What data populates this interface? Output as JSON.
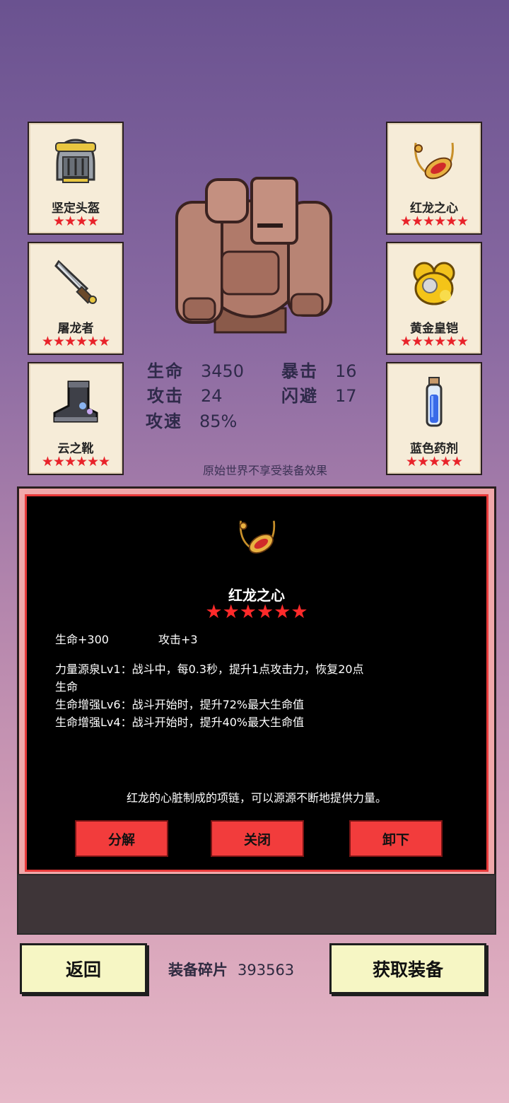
{
  "equipment": {
    "left": [
      {
        "name": "坚定头盔",
        "stars": "★★★★",
        "icon": "knight-helmet-icon"
      },
      {
        "name": "屠龙者",
        "stars": "★★★★★★",
        "icon": "dagger-icon"
      },
      {
        "name": "云之靴",
        "stars": "★★★★★★",
        "icon": "boot-icon"
      }
    ],
    "right": [
      {
        "name": "红龙之心",
        "stars": "★★★★★★",
        "icon": "ruby-necklace-icon"
      },
      {
        "name": "黄金皇铠",
        "stars": "★★★★★★",
        "icon": "golden-armor-icon"
      },
      {
        "name": "蓝色药剂",
        "stars": "★★★★★",
        "icon": "blue-potion-icon"
      }
    ]
  },
  "character": {
    "icon": "stone-golem-icon"
  },
  "stats": {
    "hp_label": "生命",
    "hp": "3450",
    "crit_label": "暴击",
    "crit": "16",
    "atk_label": "攻击",
    "atk": "24",
    "dodge_label": "闪避",
    "dodge": "17",
    "spd_label": "攻速",
    "spd": "85%"
  },
  "note": "原始世界不享受装备效果",
  "detail": {
    "icon": "ruby-necklace-icon",
    "name": "红龙之心",
    "stars": "★★★★★★",
    "bonus_hp": "生命+300",
    "bonus_atk": "攻击+3",
    "skill1_line1": "力量源泉Lv1：战斗中，每0.3秒，提升1点攻击力，恢复20点",
    "skill1_line2": "生命",
    "skill2": "生命增强Lv6：战斗开始时，提升72%最大生命值",
    "skill3": "生命增强Lv4：战斗开始时，提升40%最大生命值",
    "description": "红龙的心脏制成的项链，可以源源不断地提供力量。",
    "btn_decompose": "分解",
    "btn_close": "关闭",
    "btn_unequip": "卸下"
  },
  "footer": {
    "back": "返回",
    "shards_label": "装备碎片",
    "shards_value": "393563",
    "get_equipment": "获取装备"
  },
  "colors": {
    "star": "#e8232a",
    "button_red": "#f23c3c",
    "panel_border": "#e83a3a",
    "footer_button": "#f6f6c4"
  }
}
